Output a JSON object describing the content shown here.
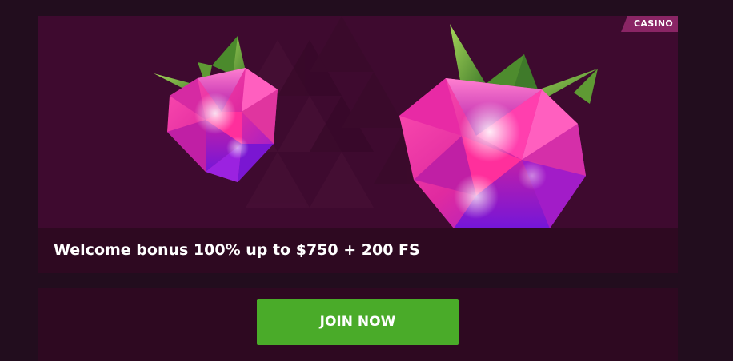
{
  "promo": {
    "tag": "CASINO",
    "title": "Welcome bonus 100% up to $750 + 200 FS",
    "art": [
      "raspberry-gem-small-icon",
      "raspberry-gem-large-icon"
    ]
  },
  "cta": {
    "label": "JOIN NOW"
  },
  "colors": {
    "page_background": "#220d1e",
    "banner_background": "#3e0a2f",
    "panel_background": "#2e0921",
    "tag_background": "#8a2565",
    "button_green": "#4aab29",
    "text": "#ffffff"
  }
}
